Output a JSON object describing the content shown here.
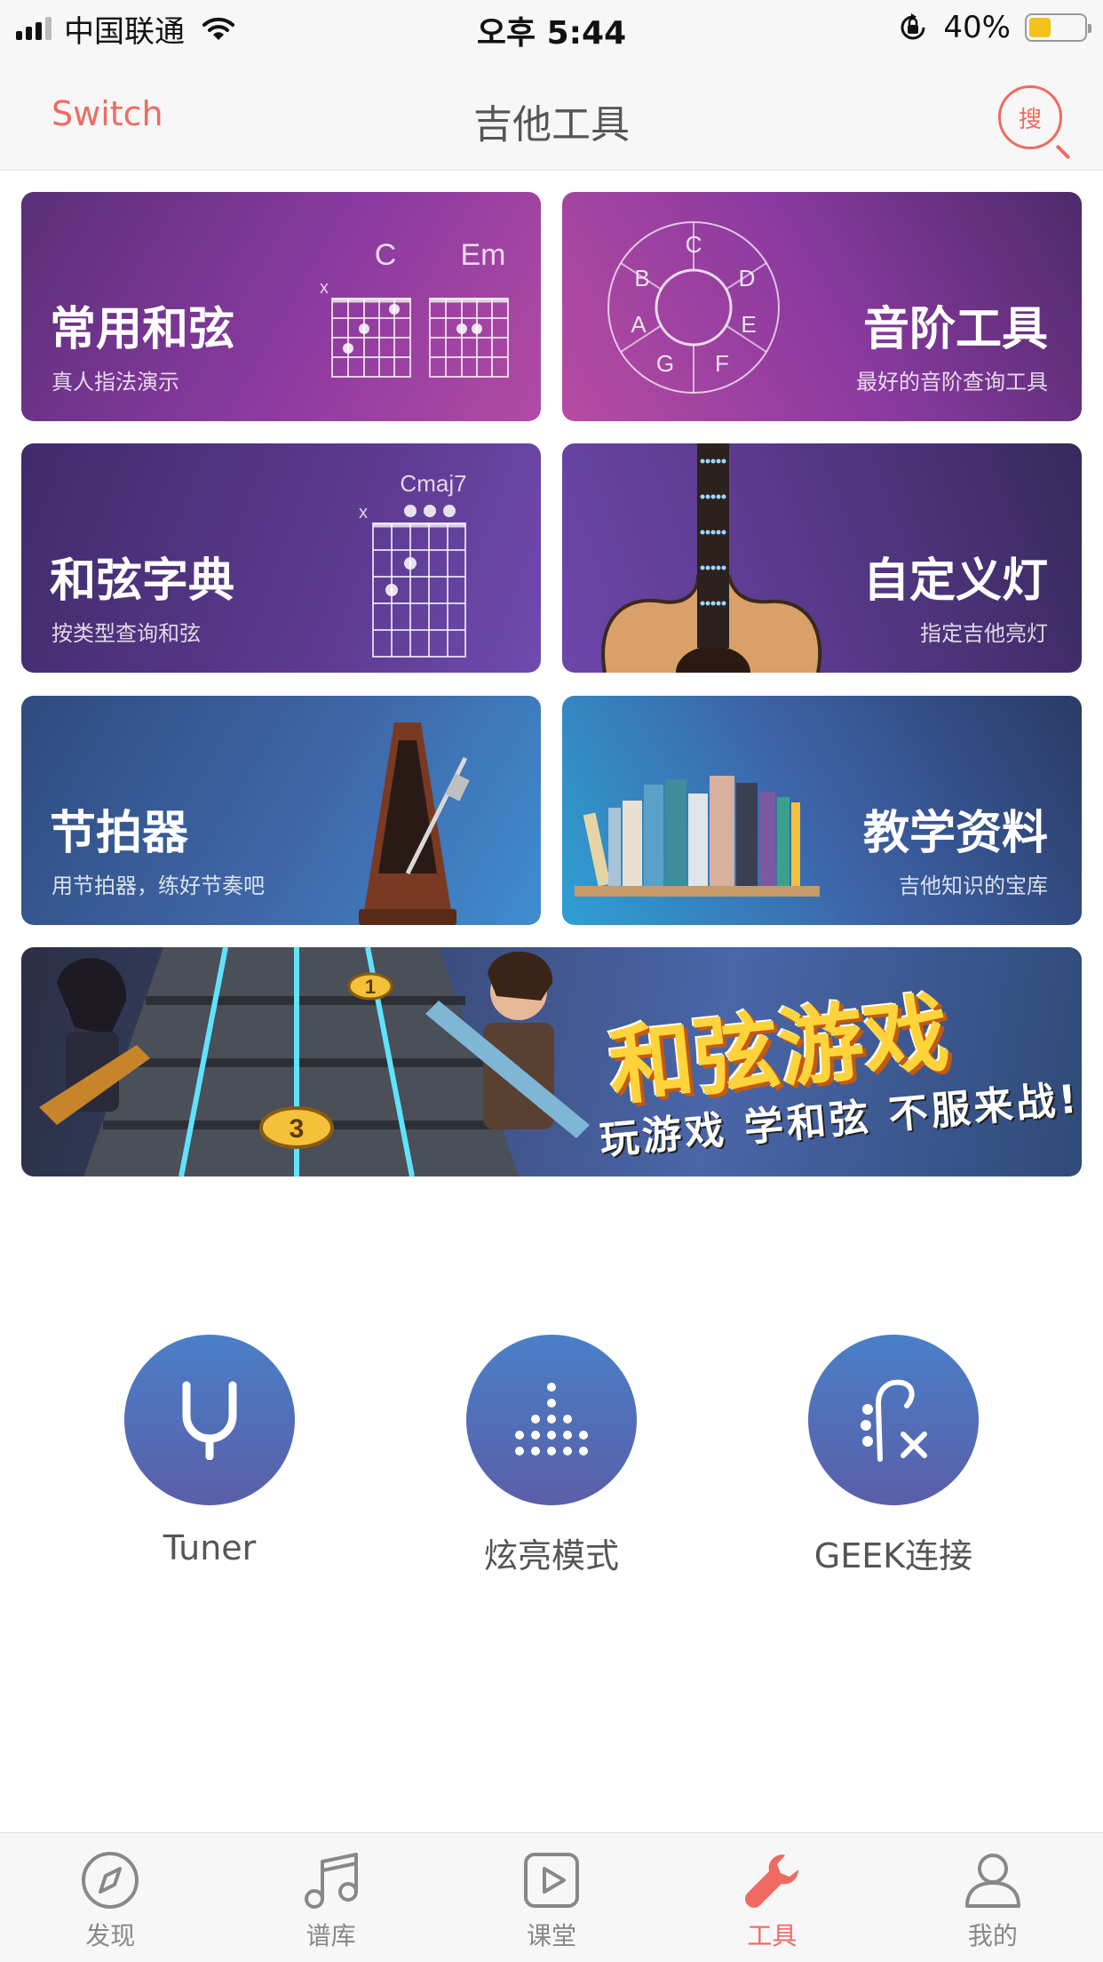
{
  "status_bar": {
    "carrier": "中国联通",
    "time": "오후 5:44",
    "battery_percent": "40%",
    "battery_level": 0.4,
    "icons": [
      "signal-icon",
      "wifi-icon",
      "rotation-lock-icon",
      "battery-icon"
    ]
  },
  "nav": {
    "switch_label": "Switch",
    "title": "吉他工具",
    "search_label": "搜"
  },
  "cards": [
    {
      "title": "常用和弦",
      "subtitle": "真人指法演示",
      "art": {
        "chord1": "C",
        "chord2": "Em",
        "mute": "x"
      }
    },
    {
      "title": "音阶工具",
      "subtitle": "最好的音阶查询工具",
      "art": {
        "notes": [
          "C",
          "D",
          "E",
          "F",
          "G",
          "A",
          "B"
        ]
      }
    },
    {
      "title": "和弦字典",
      "subtitle": "按类型查询和弦",
      "art": {
        "chord": "Cmaj7",
        "mute": "x"
      }
    },
    {
      "title": "自定义灯",
      "subtitle": "指定吉他亮灯"
    },
    {
      "title": "节拍器",
      "subtitle": "用节拍器，练好节奏吧"
    },
    {
      "title": "教学资料",
      "subtitle": "吉他知识的宝库"
    }
  ],
  "banner": {
    "title": "和弦游戏",
    "subtitle": "玩游戏 学和弦 不服来战!",
    "markers": [
      "1",
      "3"
    ]
  },
  "tools": [
    {
      "label": "Tuner",
      "icon": "tuning-fork-icon"
    },
    {
      "label": "炫亮模式",
      "icon": "dots-equalizer-icon"
    },
    {
      "label": "GEEK连接",
      "icon": "guitar-headstock-icon"
    }
  ],
  "tabbar": {
    "items": [
      {
        "label": "发现",
        "icon": "compass-icon",
        "active": false
      },
      {
        "label": "谱库",
        "icon": "music-note-icon",
        "active": false
      },
      {
        "label": "课堂",
        "icon": "play-icon",
        "active": false
      },
      {
        "label": "工具",
        "icon": "wrench-icon",
        "active": true
      },
      {
        "label": "我的",
        "icon": "person-icon",
        "active": false
      }
    ]
  },
  "colors": {
    "accent": "#f06a61",
    "tool_circle_top": "#4a7fc8",
    "tool_circle_bottom": "#5a5ea8"
  }
}
